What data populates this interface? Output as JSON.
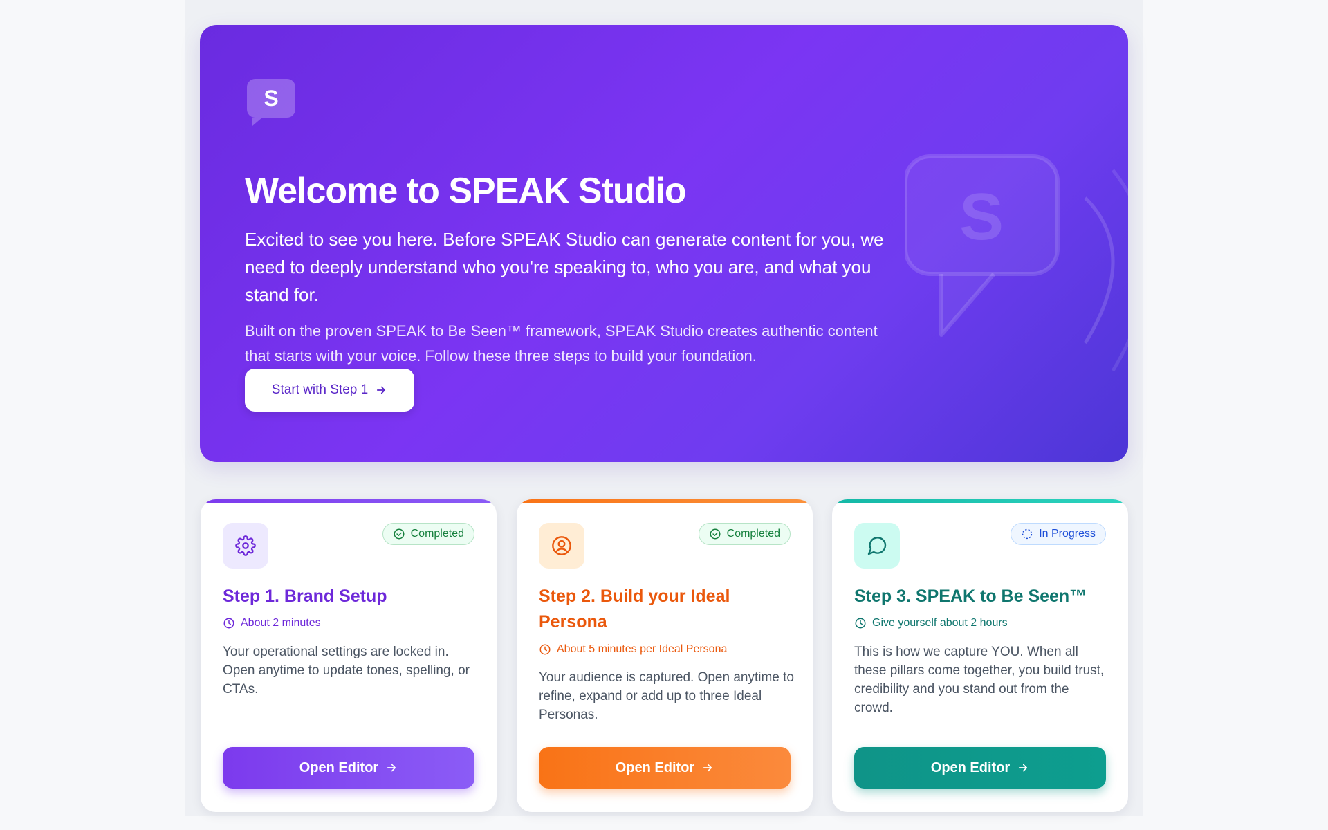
{
  "hero": {
    "logo_letter": "S",
    "title": "Welcome to SPEAK Studio",
    "intro": "Excited to see you here. Before SPEAK Studio can generate content for you, we need to deeply understand who you're speaking to, who you are, and what you stand for.",
    "subtext": "Built on the proven SPEAK to Be Seen™ framework, SPEAK Studio creates authentic content that starts with your voice. Follow these three steps to build your foundation.",
    "cta_label": "Start with Step 1",
    "cta_icon": "arrow-right-icon",
    "decor_letter": "S"
  },
  "steps": [
    {
      "title": "Step 1. Brand Setup",
      "icon": "gear-icon",
      "status": "Completed",
      "time": "About 2 minutes",
      "description": "Your operational settings are locked in. Open anytime to update tones, spelling, or CTAs.",
      "button_label": "Open Editor",
      "accent": "#6d28d9"
    },
    {
      "title": "Step 2. Build your Ideal Persona",
      "icon": "user-circle-icon",
      "status": "Completed",
      "time": "About 5 minutes per Ideal Persona",
      "description": "Your audience is captured. Open anytime to refine, expand or add up to three Ideal Personas.",
      "button_label": "Open Editor",
      "accent": "#ea580c"
    },
    {
      "title": "Step 3. SPEAK to Be Seen™",
      "icon": "chat-bubble-icon",
      "status": "In Progress",
      "time": "Give yourself about 2 hours",
      "description": "This is how we capture YOU. When all these pillars come together, you build trust, credibility and you stand out from the crowd.",
      "button_label": "Open Editor",
      "accent": "#0f766e"
    }
  ],
  "colors": {
    "hero_start": "#6a2be0",
    "hero_end": "#4c36d6",
    "completed": "#15803d",
    "in_progress": "#1d4ed8"
  }
}
